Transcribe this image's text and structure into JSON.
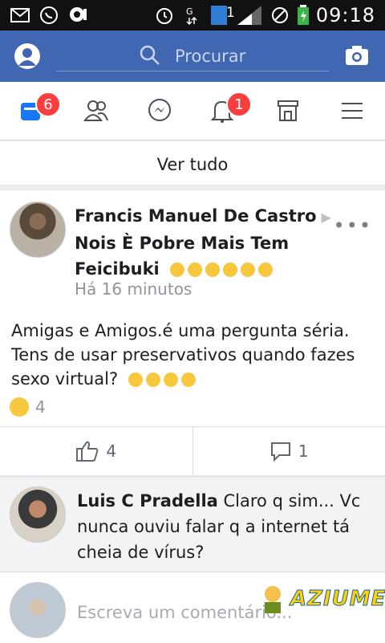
{
  "status_bar": {
    "time": "09:18",
    "sim_indicator": "1",
    "icons": [
      "mail-icon",
      "whatsapp-icon",
      "voicemail-icon",
      "alarm-icon",
      "data-icon",
      "sim-icon",
      "signal-icon",
      "blocked-icon",
      "battery-icon"
    ]
  },
  "header": {
    "search_placeholder": "Procurar"
  },
  "nav": {
    "feed_badge": "6",
    "notifications_badge": "1"
  },
  "feed": {
    "see_all": "Ver tudo"
  },
  "post": {
    "author": "Francis Manuel De Castro",
    "group": "Nois È Pobre Mais Tem Feicibuki",
    "time": "Há 16 minutos",
    "text": "Amigas e Amigos.é uma pergunta séria. Tens de usar preservativos quando fazes sexo virtual?",
    "reactions_count": "4",
    "like_count": "4",
    "comment_count": "1"
  },
  "comment": {
    "author": "Luis C Pradella",
    "text": "Claro q sim... Vc nunca ouviu falar q a internet tá cheia de vírus?"
  },
  "composer": {
    "placeholder": "Escreva um comentário..."
  },
  "watermark": {
    "text": "AZIUME"
  },
  "colors": {
    "brand": "#4267b2",
    "badge": "#fa3e3e",
    "muted": "#90949c"
  }
}
